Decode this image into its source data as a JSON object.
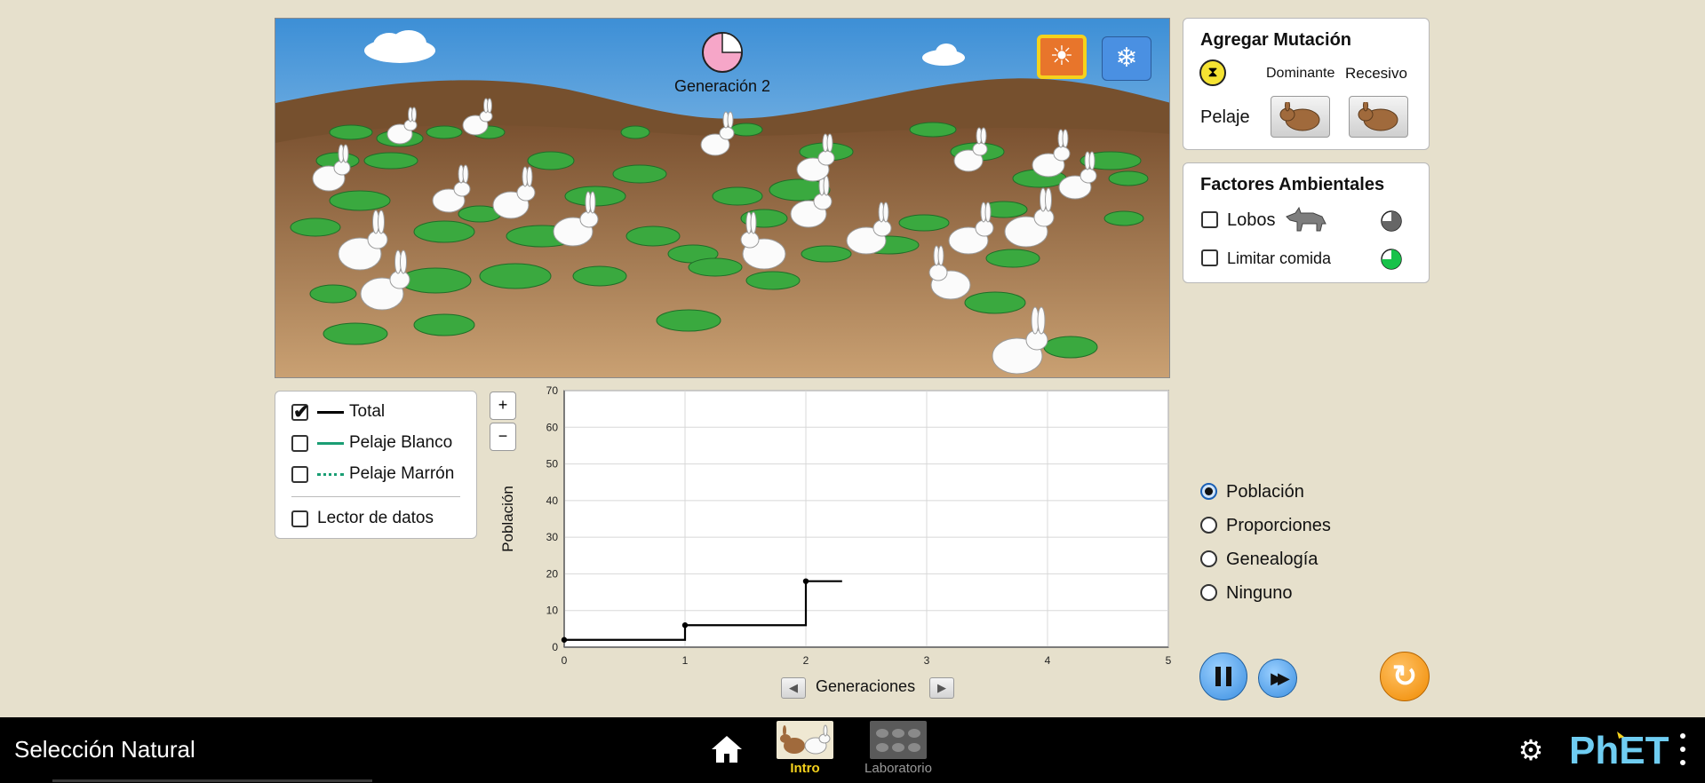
{
  "sim": {
    "generation_label": "Generación 2",
    "title": "Selección Natural"
  },
  "mutation_panel": {
    "title": "Agregar Mutación",
    "dominant_label": "Dominante",
    "recessive_label": "Recesivo",
    "trait_label": "Pelaje"
  },
  "environment_panel": {
    "title": "Factores Ambientales",
    "wolves_label": "Lobos",
    "wolves_checked": false,
    "food_label": "Limitar comida",
    "food_checked": false
  },
  "legend": {
    "items": [
      {
        "label": "Total",
        "checked": true,
        "color": "#000000",
        "style": "solid"
      },
      {
        "label": "Pelaje Blanco",
        "checked": false,
        "color": "#1a9e74",
        "style": "solid"
      },
      {
        "label": "Pelaje Marrón",
        "checked": false,
        "color": "#1a9e74",
        "style": "dotted"
      }
    ],
    "data_reader_label": "Lector de datos",
    "data_reader_checked": false,
    "zoom_in": "+",
    "zoom_out": "−"
  },
  "graph_selector": {
    "options": [
      "Población",
      "Proporciones",
      "Genealogía",
      "Ninguno"
    ],
    "selected": "Población"
  },
  "navbar": {
    "tabs": [
      {
        "label": "Intro",
        "active": true
      },
      {
        "label": "Laboratorio",
        "active": false
      }
    ],
    "brand": "PhET"
  },
  "chart_data": {
    "type": "line",
    "xlabel": "Generaciones",
    "ylabel": "Población",
    "xlim": [
      0,
      5
    ],
    "ylim": [
      0,
      70
    ],
    "xticks": [
      0,
      1,
      2,
      3,
      4,
      5
    ],
    "yticks": [
      0,
      10,
      20,
      30,
      40,
      50,
      60,
      70
    ],
    "grid": true,
    "series": [
      {
        "name": "Total",
        "color": "#000000",
        "step": true,
        "x": [
          0,
          1,
          2,
          2.3
        ],
        "y": [
          2,
          6,
          18,
          18
        ],
        "markers_at": [
          0,
          1,
          2
        ]
      }
    ]
  }
}
